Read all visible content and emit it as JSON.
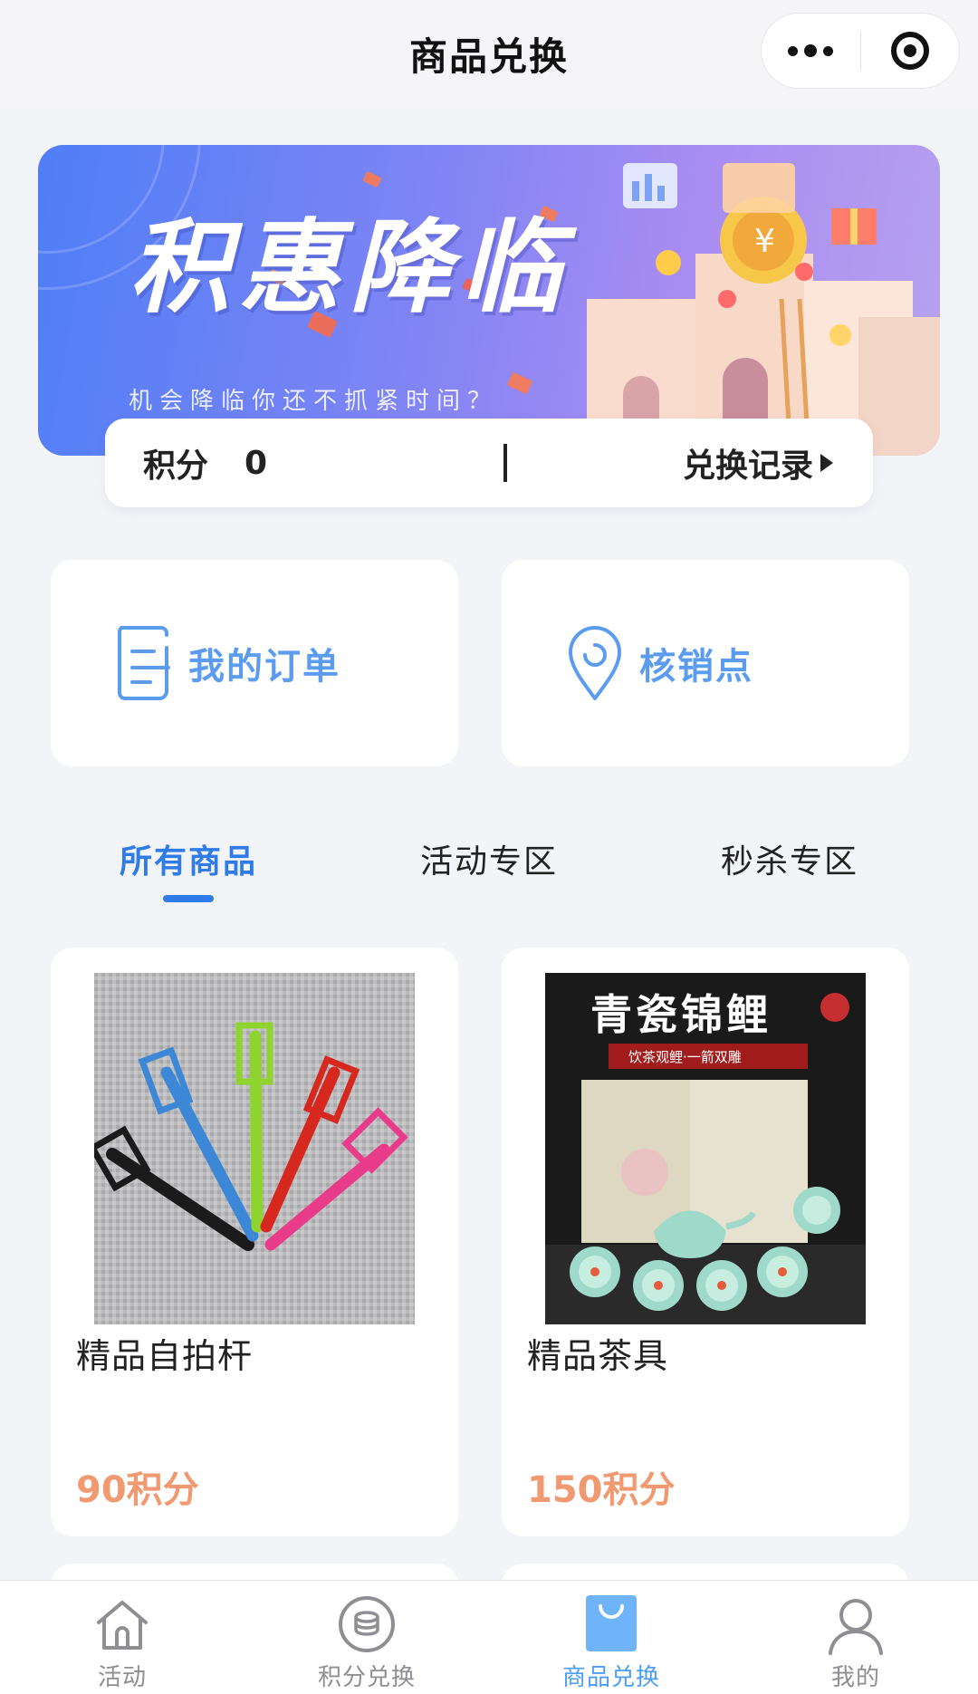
{
  "nav": {
    "title": "商品兑换",
    "more_icon": "more-dots-icon",
    "close_icon": "target-close-icon"
  },
  "banner": {
    "headline": "积惠降临",
    "subtitle": "机会降临你还不抓紧时间？"
  },
  "points": {
    "label": "积分",
    "value": "0",
    "record_label": "兑换记录"
  },
  "quick_links": [
    {
      "label": "我的订单",
      "icon": "order-list-icon"
    },
    {
      "label": "核销点",
      "icon": "location-pin-icon"
    }
  ],
  "tabs": [
    {
      "label": "所有商品",
      "active": true
    },
    {
      "label": "活动专区",
      "active": false
    },
    {
      "label": "秒杀专区",
      "active": false
    }
  ],
  "products": [
    {
      "name": "精品自拍杆",
      "price": "90积分",
      "image": "selfie-stick-photo"
    },
    {
      "name": "精品茶具",
      "price": "150积分",
      "image": "tea-set-photo",
      "image_title": "青瓷锦鲤",
      "image_caption": "饮茶观鲤·一箭双雕"
    }
  ],
  "tabbar": [
    {
      "label": "活动",
      "icon": "home-icon",
      "active": false
    },
    {
      "label": "积分兑换",
      "icon": "coin-stack-icon",
      "active": false
    },
    {
      "label": "商品兑换",
      "icon": "shopping-bag-icon",
      "active": true
    },
    {
      "label": "我的",
      "icon": "user-icon",
      "active": false
    }
  ],
  "colors": {
    "accent": "#2f7be8",
    "quick_link": "#5b9cf0",
    "price": "#f19a72",
    "tab_active": "#4c9ef5",
    "background": "#f3f4f7"
  }
}
